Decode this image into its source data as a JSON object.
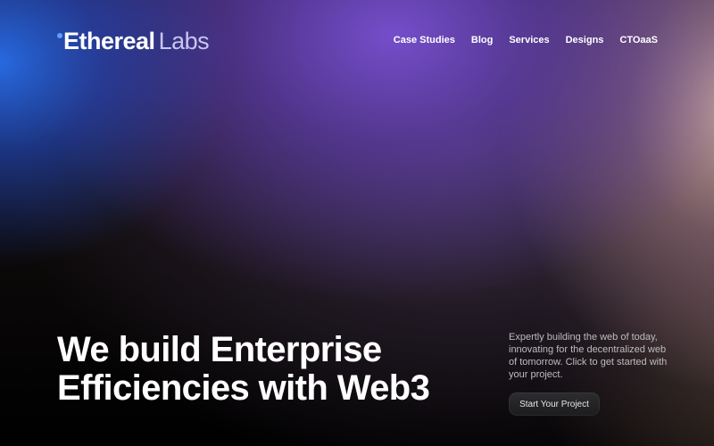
{
  "header": {
    "logo": {
      "part1": "Ethereal",
      "part2": "Labs",
      "accent_color": "#5aa0ff"
    },
    "nav": [
      {
        "label": "Case Studies"
      },
      {
        "label": "Blog"
      },
      {
        "label": "Services"
      },
      {
        "label": "Designs"
      },
      {
        "label": "CTOaaS"
      }
    ]
  },
  "hero": {
    "headline_line1": "We build Enterprise",
    "headline_line2": "Efficiencies with Web3",
    "blurb": "Expertly building the web of today, innovating for the decentralized web of tomorrow. Click to get started with your project.",
    "cta_label": "Start Your Project"
  },
  "colors": {
    "background_base": "#000000",
    "gradient_blue": "#286eeb",
    "gradient_purple": "#7850d2",
    "gradient_peach": "#cdaaa0",
    "cta_background": "#2d2d30"
  }
}
